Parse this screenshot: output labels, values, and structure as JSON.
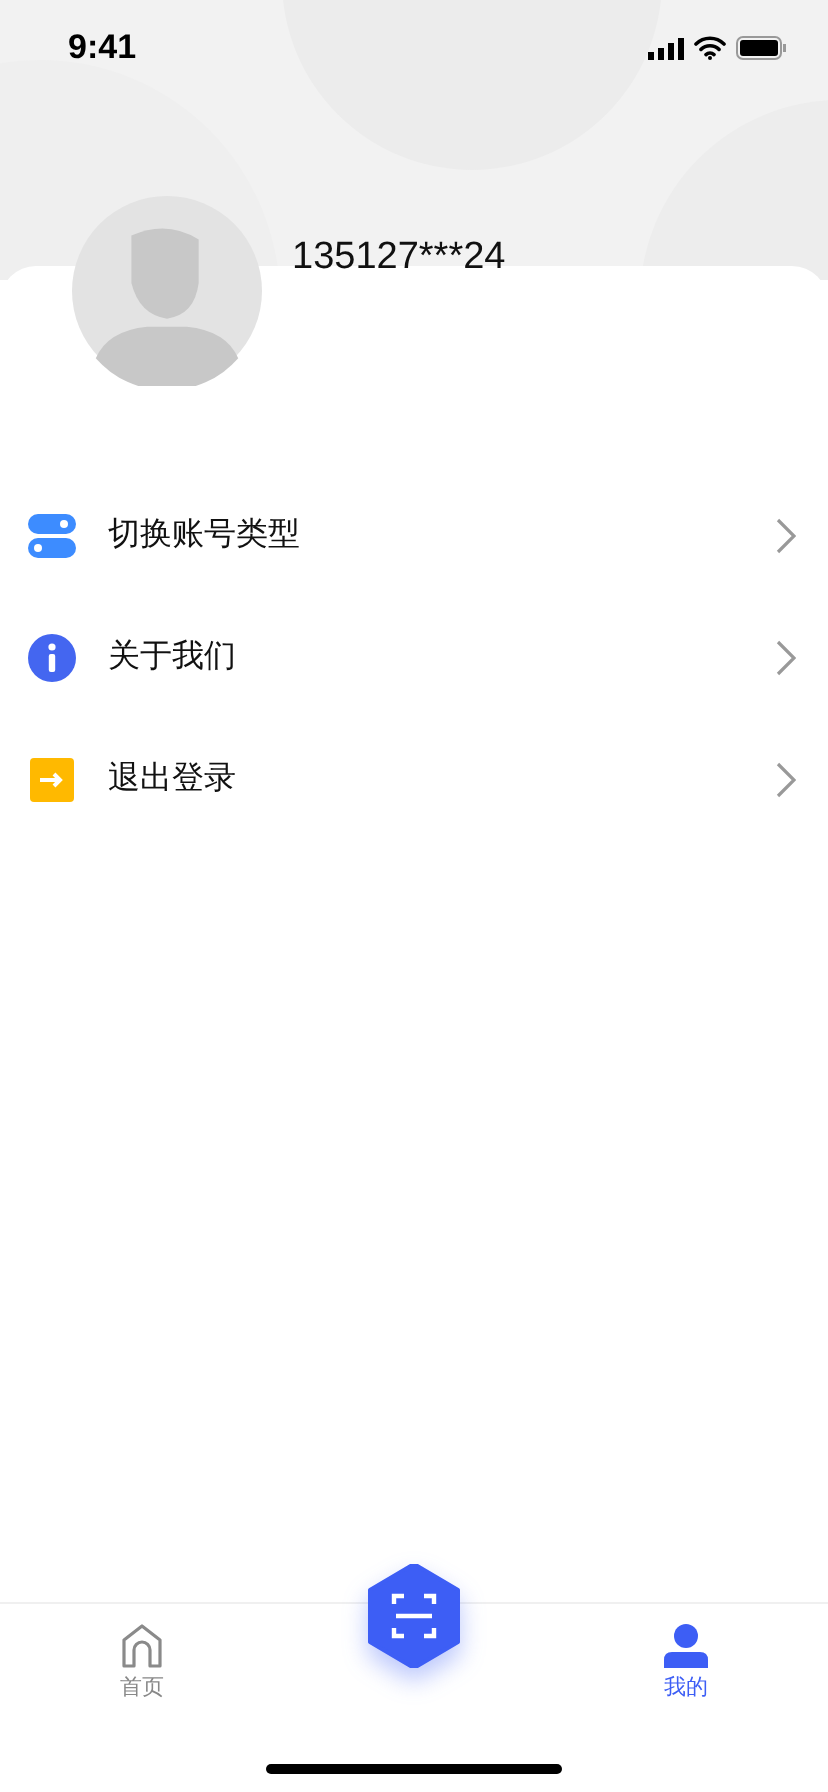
{
  "status_bar": {
    "time": "9:41"
  },
  "profile": {
    "phone": "135127***24"
  },
  "menu": [
    {
      "kind": "switch",
      "label": "切换账号类型"
    },
    {
      "kind": "info",
      "label": "关于我们"
    },
    {
      "kind": "logout",
      "label": "退出登录"
    }
  ],
  "tab_bar": {
    "tabs": [
      {
        "kind": "home",
        "label": "首页",
        "selected": false
      },
      {
        "kind": "scan"
      },
      {
        "kind": "me",
        "label": "我的",
        "selected": true
      }
    ]
  }
}
